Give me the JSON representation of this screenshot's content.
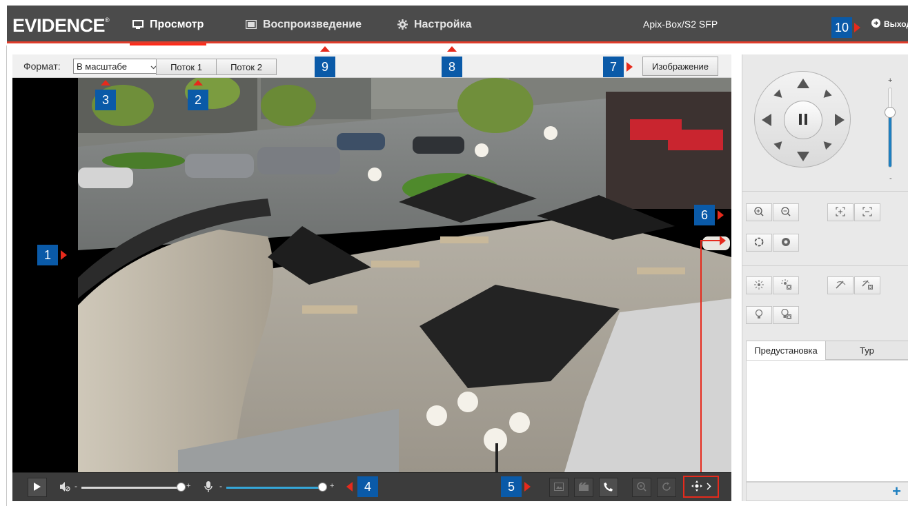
{
  "header": {
    "logo": "EVIDENCE",
    "logo_mark": "®",
    "tabs": [
      {
        "label": "Просмотр",
        "icon": "monitor-icon",
        "active": true
      },
      {
        "label": "Воспроизведение",
        "icon": "film-icon",
        "active": false
      },
      {
        "label": "Настройка",
        "icon": "gear-icon",
        "active": false
      }
    ],
    "device_name": "Apix-Box/S2 SFP",
    "logout_label": "Выход"
  },
  "toolbar": {
    "format_label": "Формат:",
    "format_value": "В масштабе",
    "stream1_label": "Поток 1",
    "stream2_label": "Поток 2",
    "image_button_label": "Изображение"
  },
  "callouts": {
    "c1": "1",
    "c2": "2",
    "c3": "3",
    "c4": "4",
    "c5": "5",
    "c6": "6",
    "c7": "7",
    "c8": "8",
    "c9": "9",
    "c10": "10"
  },
  "controls": {
    "play_icon": "play-icon",
    "volume_icon": "speaker-muted-icon",
    "mic_icon": "microphone-icon",
    "volume_level": 1.0,
    "mic_level": 1.0,
    "right_icons": [
      "snapshot-icon",
      "record-icon",
      "talk-icon",
      "digital-zoom-icon",
      "3d-positioning-icon",
      "ptz-toggle-icon"
    ]
  },
  "ptz": {
    "speed_plus": "+",
    "speed_minus": "-",
    "speed_level": 0.7,
    "tabs": [
      "Предустановка",
      "Тур"
    ],
    "add_label": "+"
  },
  "colors": {
    "accent_red": "#e03d2c",
    "callout_blue": "#0a5aa8",
    "topbar": "#4b4b4b",
    "slider_blue": "#1e7fc0"
  }
}
